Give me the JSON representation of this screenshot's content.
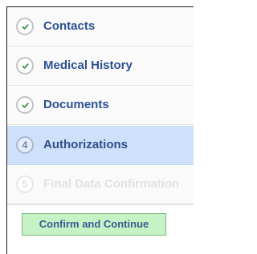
{
  "steps": [
    {
      "label": "Contacts",
      "marker": "",
      "state": "complete",
      "icon": "check-icon"
    },
    {
      "label": "Medical History",
      "marker": "",
      "state": "complete",
      "icon": "check-icon"
    },
    {
      "label": "Documents",
      "marker": "",
      "state": "complete",
      "icon": "check-icon"
    },
    {
      "label": "Authorizations",
      "marker": "4",
      "state": "active"
    },
    {
      "label": "Final Data Confirmation",
      "marker": "5",
      "state": "disabled"
    }
  ],
  "confirm_button": {
    "label": "Confirm and Continue"
  },
  "colors": {
    "check": "#2e8b3c",
    "label": "#2c4f92",
    "active_background": "#cfe0fa",
    "button_background": "#c6f2c6",
    "button_border": "#7db87d"
  }
}
